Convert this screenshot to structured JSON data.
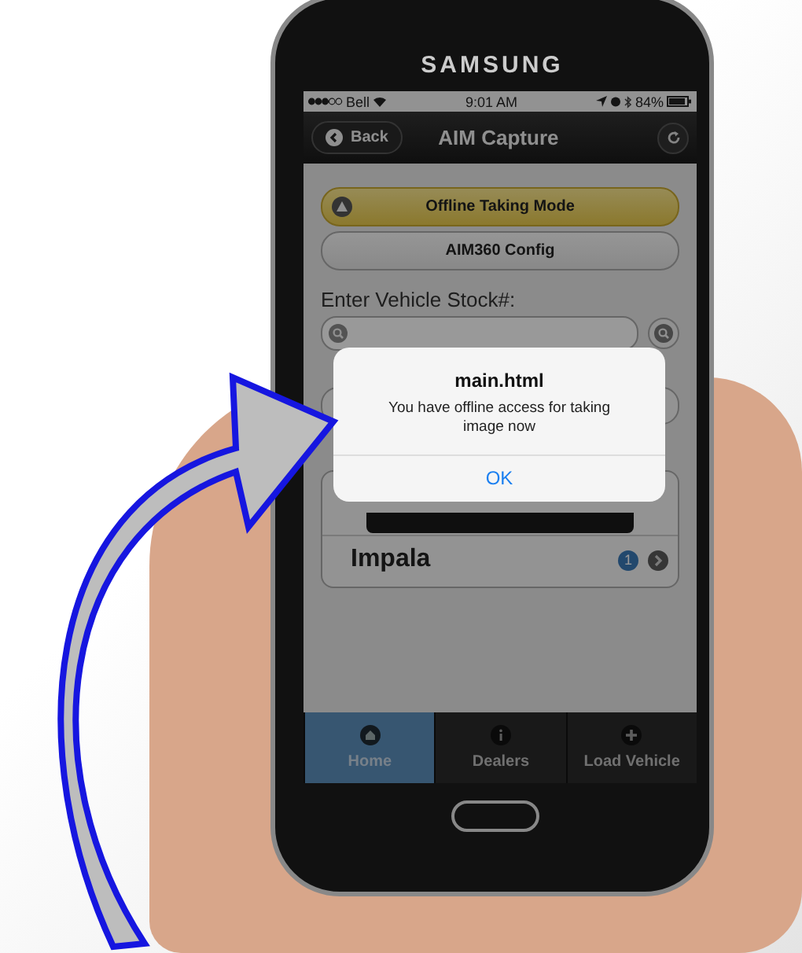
{
  "device": {
    "brand": "SAMSUNG"
  },
  "status_bar": {
    "carrier": "Bell",
    "time": "9:01 AM",
    "battery": "84%"
  },
  "header": {
    "back": "Back",
    "title": "AIM Capture"
  },
  "buttons": [
    {
      "label": "Offline Taking Mode",
      "kind": "warning"
    },
    {
      "label": "AIM360 Config",
      "kind": "plain"
    }
  ],
  "stock": {
    "label": "Enter Vehicle Stock#:"
  },
  "list": [
    {
      "title": "Impala",
      "count": "1"
    }
  ],
  "dialog": {
    "title": "main.html",
    "message": "You have offline access for taking image now",
    "ok": "OK"
  },
  "tabs": [
    {
      "label": "Home",
      "kind": "home",
      "selected": true
    },
    {
      "label": "Dealers",
      "kind": "info",
      "selected": false
    },
    {
      "label": "Load Vehicle",
      "kind": "plus",
      "selected": false
    }
  ]
}
